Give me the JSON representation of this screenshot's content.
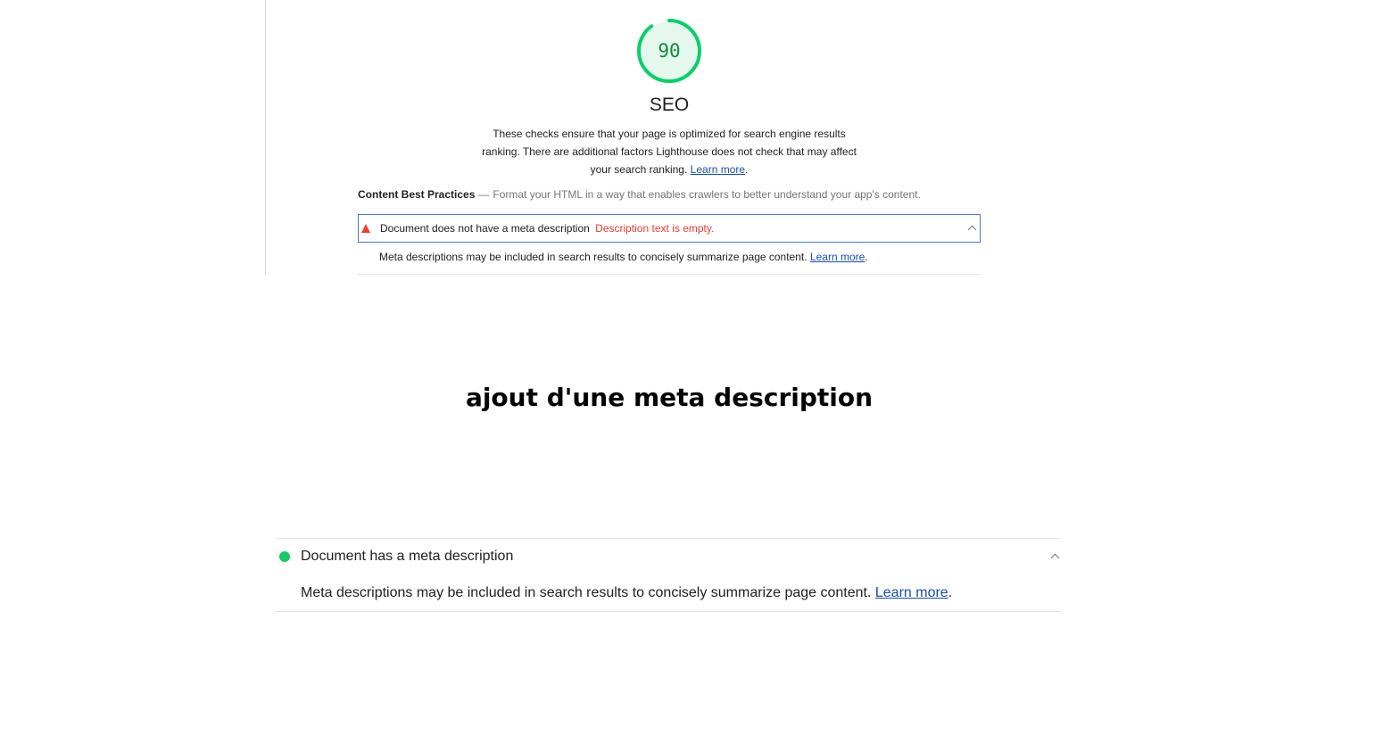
{
  "before": {
    "score": "90",
    "score_level": 0.9,
    "category_title": "SEO",
    "category_description": "These checks ensure that your page is optimized for search engine results ranking. There are additional factors Lighthouse does not check that may affect your search ranking.",
    "category_learn_more": "Learn more",
    "group_title": "Content Best Practices",
    "group_separator": "—",
    "group_description": "Format your HTML in a way that enables crawlers to better understand your app's content.",
    "audit": {
      "title": "Document does not have a meta description",
      "display_value": "Description text is empty.",
      "description": "Meta descriptions may be included in search results to concisely summarize page content.",
      "learn_more": "Learn more",
      "status": "fail",
      "expanded": true
    }
  },
  "caption": "ajout d'une meta description",
  "after": {
    "audit": {
      "title": "Document has a meta description",
      "description": "Meta descriptions may be included in search results to concisely summarize page content.",
      "learn_more": "Learn more",
      "status": "pass",
      "expanded": true
    }
  },
  "colors": {
    "pass": "#0cce6b",
    "fail": "#eb4034",
    "link": "#1a4fa3",
    "focus_border": "#4a79c6"
  }
}
